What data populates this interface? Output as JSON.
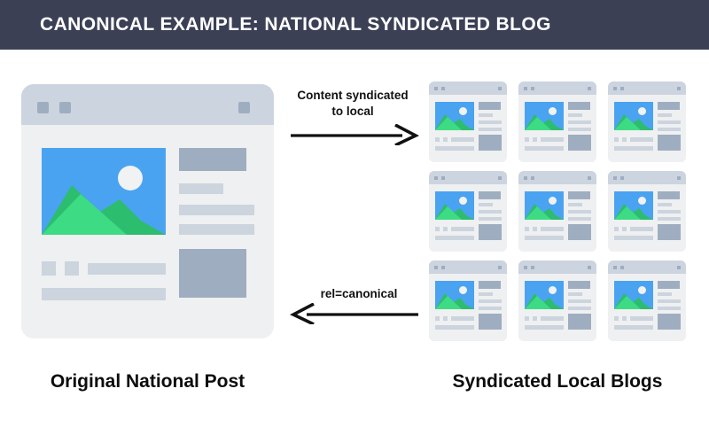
{
  "header": {
    "title": "CANONICAL EXAMPLE: NATIONAL SYNDICATED BLOG",
    "background_color": "#3b4055",
    "text_color": "#ffffff"
  },
  "palette": {
    "page_background": "#ffffff",
    "browser_body": "#eff0f1",
    "browser_titlebar": "#ccd4e0",
    "placeholder_light": "#ccd4de",
    "placeholder_dark": "#9fadc0",
    "image_sky": "#4aa3f0",
    "image_sun": "#f1f2f3",
    "image_mountain_back": "#2dbd6e",
    "image_mountain_front": "#3ddc84",
    "arrow_color": "#111111",
    "caption_color": "#0d0d0d"
  },
  "diagram": {
    "left_mock": {
      "name": "original-national-post-browser",
      "caption": "Original National Post",
      "titlebar_dots": 3
    },
    "right_mock": {
      "name": "syndicated-local-blogs-grid",
      "caption": "Syndicated Local Blogs",
      "columns": 3,
      "rows": 3,
      "count": 9
    },
    "arrows": [
      {
        "id": "syndication-arrow",
        "direction": "right",
        "label_line_1": "Content syndicated",
        "label_line_2": "to local"
      },
      {
        "id": "canonical-arrow",
        "direction": "left",
        "label_line_1": "rel=canonical",
        "label_line_2": ""
      }
    ]
  }
}
